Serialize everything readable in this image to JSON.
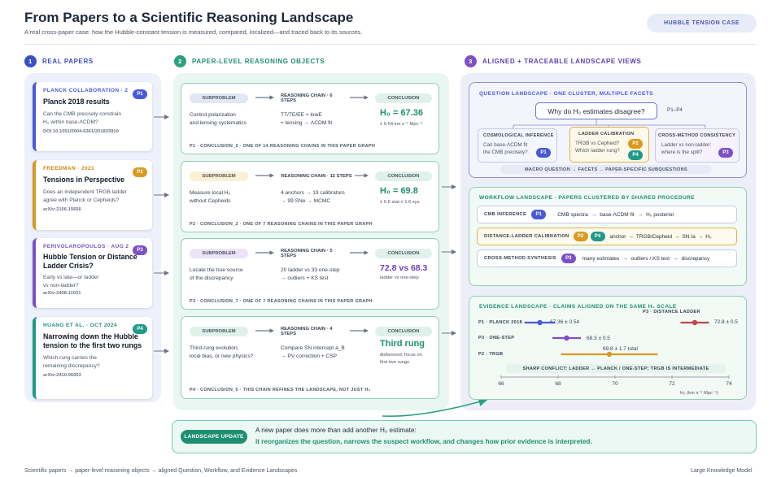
{
  "header": {
    "title": "From Papers to a Scientific Reasoning Landscape",
    "subtitle": "A real cross-paper case: how the Hubble-constant tension is measured, compared, localized—and traced back to its sources.",
    "badge": "HUBBLE TENSION CASE"
  },
  "columns": [
    {
      "num": "1",
      "label": "REAL PAPERS"
    },
    {
      "num": "2",
      "label": "PAPER-LEVEL REASONING OBJECTS"
    },
    {
      "num": "3",
      "label": "ALIGNED + TRACEABLE LANDSCAPE VIEWS"
    }
  ],
  "papers": [
    {
      "head": "PLANCK COLLABORATION · 2",
      "tag": "P1",
      "title": "Planck 2018 results",
      "q1": "Can the CMB precisely constrain",
      "q2": "H₀ within base-ΛCDM?",
      "id": "DOI 10.1051/0004-6361/201833910"
    },
    {
      "head": "FREEDMAN · 2021",
      "tag": "P2",
      "title": "Tensions in Perspective",
      "q1": "Does an independent TRGB ladder",
      "q2": "agree with Planck or Cepheids?",
      "id": "arXiv:2106.15656"
    },
    {
      "head": "PERIVOLAROPOULOS · AUG 2",
      "tag": "P3",
      "title": "Hubble Tension or Distance Ladder Crisis?",
      "q1": "Early vs late—or ladder",
      "q2": "vs non-ladder?",
      "id": "arXiv:2408.11031"
    },
    {
      "head": "HUANG ET AL. · OCT 2024",
      "tag": "P4",
      "title": "Narrowing down the Hubble tension to the first two rungs",
      "q1": "Which rung carries the",
      "q2": "remaining discrepancy?",
      "id": "arXiv:2410.06053"
    }
  ],
  "reasoning": [
    {
      "sub": "SUBPROBLEM",
      "chain": "REASONING CHAIN · 6 STEPS",
      "con": "CONCLUSION",
      "s1": "Control polarization",
      "s2": "and lensing systematics",
      "c1": "TT/TE/EE + lowE",
      "c2": "+ lensing → ΛCDM fit",
      "main": "H₀ = 67.36",
      "sub1": "± 0.54 km s⁻¹ Mpc⁻¹",
      "sub2": "",
      "foot": "P1 · CONCLUSION_2 · ONE OF 14 REASONING CHAINS IN THIS PAPER GRAPH"
    },
    {
      "sub": "SUBPROBLEM",
      "chain": "REASONING CHAIN · 12 STEPS",
      "con": "CONCLUSION",
      "s1": "Measure local H₀",
      "s2": "without Cepheids",
      "c1": "4 anchors → 19 calibrators",
      "c2": "→ 99 SNe → MCMC",
      "main": "H₀ = 69.8",
      "sub1": "± 0.6 stat ± 1.6 sys",
      "sub2": "",
      "foot": "P2 · CONCLUSION_2 · ONE OF 7 REASONING CHAINS IN THIS PAPER GRAPH"
    },
    {
      "sub": "SUBPROBLEM",
      "chain": "REASONING CHAIN · 5 STEPS",
      "con": "CONCLUSION",
      "s1": "Locate the true source",
      "s2": "of the discrepancy",
      "c1": "20 ladder vs 33 one-step",
      "c2": "→ outliers + KS test",
      "main": "72.8 vs 68.3",
      "sub1": "ladder vs one-step",
      "sub2": "",
      "foot": "P3 · CONCLUSION_7 · ONE OF 7 REASONING CHAINS IN THIS PAPER GRAPH"
    },
    {
      "sub": "SUBPROBLEM",
      "chain": "REASONING CHAIN · 4 STEPS",
      "con": "CONCLUSION",
      "s1": "Third-rung evolution,",
      "s2": "local bias, or new physics?",
      "c1": "Compare SN intercept a_B",
      "c2": "→ PV correction + CSP",
      "main": "Third rung",
      "sub1": "disfavored; focus on",
      "sub2": "first two rungs",
      "foot": "P4 · CONCLUSION_5 · THIS CHAIN REFINES THE LANDSCAPE, NOT JUST H₀"
    }
  ],
  "question": {
    "title": "QUESTION LANDSCAPE · ONE CLUSTER, MULTIPLE FACETS",
    "main": "Why do H₀ estimates disagree?",
    "refs": "P1–P4",
    "facets": [
      {
        "label": "COSMOLOGICAL INFERENCE",
        "t1": "Can base-ΛCDM fit",
        "t2": "the CMB precisely?"
      },
      {
        "label": "LADDER CALIBRATION",
        "t1": "TRGB vs Cepheid?",
        "t2": "Which ladder rung?"
      },
      {
        "label": "CROSS-METHOD CONSISTENCY",
        "t1": "Ladder vs non-ladder:",
        "t2": "where is the split?"
      }
    ],
    "foot": "MACRO QUESTION → FACETS → PAPER-SPECIFIC SUBQUESTIONS"
  },
  "workflow": {
    "title": "WORKFLOW LANDSCAPE · PAPERS CLUSTERED BY SHARED PROCEDURE",
    "rows": [
      {
        "label": "CMB INFERENCE",
        "steps": [
          "CMB spectra",
          "base-ΛCDM fit",
          "H₀ posterior"
        ]
      },
      {
        "label": "DISTANCE-LADDER CALIBRATION",
        "steps": [
          "anchor",
          "TRGB/Cepheid",
          "SN Ia",
          "H₀"
        ]
      },
      {
        "label": "CROSS-METHOD SYNTHESIS",
        "steps": [
          "many estimates",
          "outliers / KS test",
          "discrepancy"
        ]
      }
    ]
  },
  "evidence": {
    "title": "EVIDENCE LANDSCAPE · CLAIMS ALIGNED ON THE SAME H₀ SCALE",
    "rows": [
      {
        "label": "P1 · PLANCK 2018",
        "value": "67.36 ± 0.54"
      },
      {
        "label": "P3 · ONE-STEP",
        "value": "68.3 ± 0.5"
      },
      {
        "label": "P2 · TRGB",
        "value": "69.8 ± 1.7 total"
      },
      {
        "label": "P3 · DISTANCE LADDER",
        "value": "72.8 ± 0.5"
      }
    ],
    "conflict": "SHARP CONFLICT: LADDER ↔ PLANCK / ONE-STEP; TRGB IS INTERMEDIATE",
    "axis": "H₀ (km s⁻¹ Mpc⁻¹)",
    "ticks": [
      "66",
      "68",
      "70",
      "72",
      "74"
    ]
  },
  "update": {
    "label": "LANDSCAPE UPDATE",
    "l1": "A new paper does more than add another H₀ estimate:",
    "l2": "it reorganizes the question, narrows the suspect workflow, and changes how prior evidence is interpreted."
  },
  "footer": {
    "left": "Scientific papers → paper-level reasoning objects → aligned Question, Workflow, and Evidence Landscapes",
    "right": "Large Knowledge Model"
  },
  "chart_data": {
    "type": "scatter",
    "xlabel": "H₀ (km s⁻¹ Mpc⁻¹)",
    "xlim": [
      65,
      75
    ],
    "x_ticks": [
      66,
      68,
      70,
      72,
      74
    ],
    "series": [
      {
        "name": "P1 · PLANCK 2018",
        "x": 67.36,
        "err": 0.54
      },
      {
        "name": "P3 · ONE-STEP",
        "x": 68.3,
        "err": 0.5
      },
      {
        "name": "P2 · TRGB",
        "x": 69.8,
        "err": 1.7
      },
      {
        "name": "P3 · DISTANCE LADDER",
        "x": 72.8,
        "err": 0.5
      }
    ]
  },
  "colors": {
    "p1": "#4a5ad6",
    "p2": "#d99a20",
    "p3": "#7b51c4",
    "p4": "#1f9a86",
    "green": "#2aa181"
  }
}
